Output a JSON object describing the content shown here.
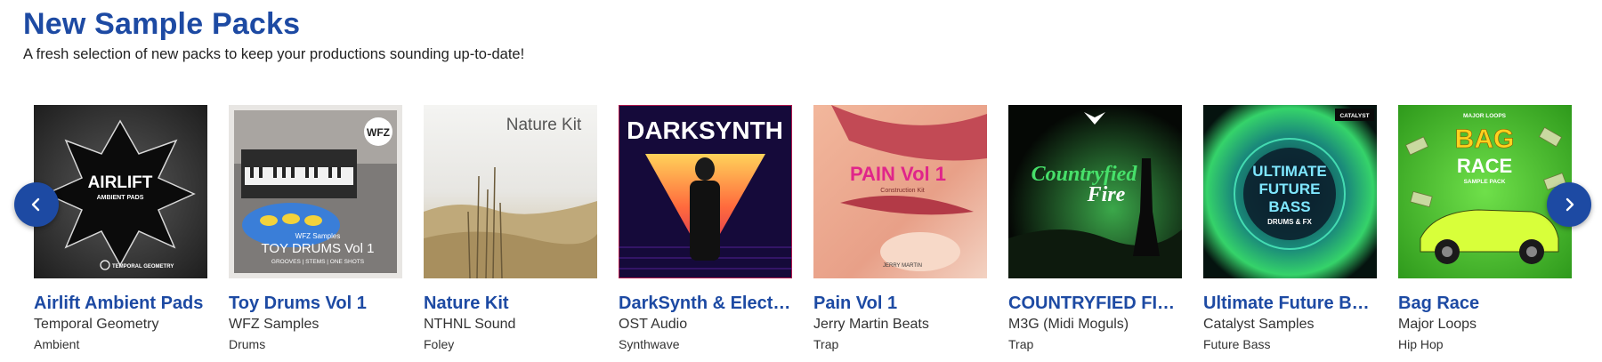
{
  "section": {
    "title": "New Sample Packs",
    "subtitle": "A fresh selection of new packs to keep your productions sounding up-to-date!"
  },
  "nav": {
    "prev_icon": "chevron-left-icon",
    "next_icon": "chevron-right-icon",
    "button_color": "#1d4aa3"
  },
  "cards": [
    {
      "title": "Airlift Ambient Pads",
      "artist": "Temporal Geometry",
      "genre": "Ambient",
      "cover": {
        "line1": "AIRLIFT",
        "line2": "AMBIENT PADS",
        "brand": "TEMPORAL GEOMETRY"
      }
    },
    {
      "title": "Toy Drums Vol 1",
      "artist": "WFZ Samples",
      "genre": "Drums",
      "cover": {
        "badge": "WFZ",
        "line0": "WFZ Samples",
        "line1": "TOY DRUMS Vol 1",
        "line2": "GROOVES | STEMS | ONE SHOTS"
      }
    },
    {
      "title": "Nature Kit",
      "artist": "NTHNL Sound",
      "genre": "Foley",
      "cover": {
        "line1": "Nature Kit"
      }
    },
    {
      "title": "DarkSynth & Elect…",
      "artist": "OST Audio",
      "genre": "Synthwave",
      "cover": {
        "line1": "DARKSYNTH"
      }
    },
    {
      "title": "Pain Vol 1",
      "artist": "Jerry Martin Beats",
      "genre": "Trap",
      "cover": {
        "line1": "PAIN Vol 1",
        "line2": "Construction Kit",
        "brand": "JERRY MARTIN"
      }
    },
    {
      "title": "COUNTRYFIED FI…",
      "artist": "M3G (Midi Moguls)",
      "genre": "Trap",
      "cover": {
        "line1": "Countryfied",
        "line2": "Fire"
      }
    },
    {
      "title": "Ultimate Future B…",
      "artist": "Catalyst Samples",
      "genre": "Future Bass",
      "cover": {
        "brand": "CATALYST",
        "line1": "ULTIMATE",
        "line2": "FUTURE",
        "line3": "BASS",
        "line4": "DRUMS & FX"
      }
    },
    {
      "title": "Bag Race",
      "artist": "Major Loops",
      "genre": "Hip Hop",
      "cover": {
        "brand": "MAJOR LOOPS",
        "line1": "BAG",
        "line2": "RACE",
        "line3": "SAMPLE PACK"
      }
    }
  ]
}
